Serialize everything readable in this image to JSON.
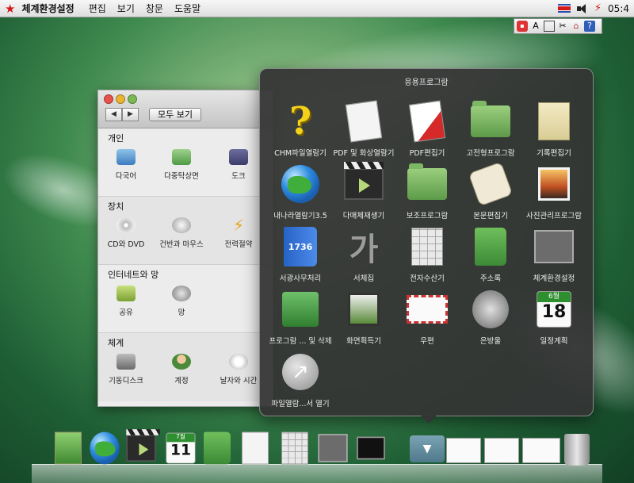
{
  "menubar": {
    "app_name": "체계환경설정",
    "menus": [
      "편집",
      "보기",
      "창문",
      "도움말"
    ],
    "clock": "05:4"
  },
  "ime": {
    "label": "A"
  },
  "prefs_window": {
    "title": "체계환경설정",
    "show_all": "모두 보기",
    "sections": [
      {
        "title": "개인",
        "items": [
          "다국어",
          "다중탁상면",
          "도크"
        ]
      },
      {
        "title": "장치",
        "items": [
          "CD와 DVD",
          "건반과 마우스",
          "전력절약"
        ]
      },
      {
        "title": "인터네트와 망",
        "items": [
          "공유",
          "망"
        ]
      },
      {
        "title": "체계",
        "items": [
          "기동디스크",
          "계정",
          "날자와 시간"
        ]
      }
    ]
  },
  "stack": {
    "title": "응용프로그람",
    "apps": [
      "CHM파일열람기",
      "PDF 및 화상열람기",
      "PDF편집기",
      "고전형프로그람",
      "기록편집기",
      "내나라열람기3.5",
      "다매체재생기",
      "보조프로그람",
      "본문편집기",
      "사진관리프로그람",
      "서광사무처리",
      "서체집",
      "전자수산기",
      "주소록",
      "체계환경설정",
      "프로그람 ... 및 삭제",
      "화면획득기",
      "우편",
      "은방울",
      "일정계획",
      "파일열람...서 열기"
    ],
    "calendar": {
      "month": "6월",
      "day": "18"
    }
  },
  "dock": {
    "calendar": {
      "month": "7월",
      "day": "11"
    }
  }
}
